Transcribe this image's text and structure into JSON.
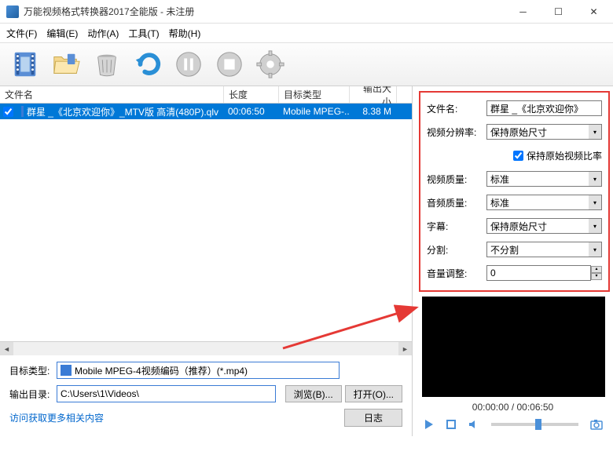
{
  "window": {
    "title": "万能视频格式转换器2017全能版 - 未注册"
  },
  "menu": {
    "file": "文件(F)",
    "edit": "编辑(E)",
    "action": "动作(A)",
    "tools": "工具(T)",
    "help": "帮助(H)"
  },
  "toolbar_icons": [
    "film",
    "folder",
    "trash",
    "redo",
    "pause",
    "stop",
    "gear"
  ],
  "columns": {
    "fname": "文件名",
    "len": "长度",
    "type": "目标类型",
    "size": "输出大小"
  },
  "rows": [
    {
      "checked": true,
      "name": "群星 _《北京欢迎你》_MTV版 高清(480P).qlv",
      "len": "00:06:50",
      "type": "Mobile MPEG-...",
      "size": "8.38 M"
    }
  ],
  "bottom": {
    "targetLabel": "目标类型:",
    "targetValue": "Mobile MPEG-4视频编码（推荐）(*.mp4)",
    "outdirLabel": "输出目录:",
    "outdirValue": "C:\\Users\\1\\Videos\\",
    "browse": "浏览(B)...",
    "open": "打开(O)...",
    "link": "访问获取更多相关内容",
    "log": "日志"
  },
  "props": {
    "fileLabel": "文件名:",
    "fileValue": "群星 _《北京欢迎你》",
    "vresLabel": "视频分辨率:",
    "vresValue": "保持原始尺寸",
    "keepAspect": "保持原始视频比率",
    "vqualLabel": "视频质量:",
    "vqualValue": "标准",
    "aqualLabel": "音频质量:",
    "aqualValue": "标准",
    "subLabel": "字幕:",
    "subValue": "保持原始尺寸",
    "splitLabel": "分割:",
    "splitValue": "不分割",
    "volLabel": "音量调整:",
    "volValue": "0"
  },
  "preview": {
    "time": "00:00:00 / 00:06:50"
  }
}
